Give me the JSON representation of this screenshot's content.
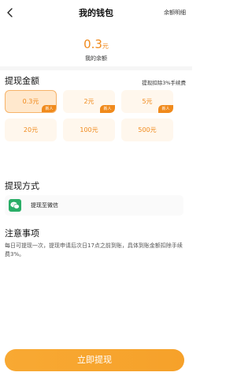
{
  "header": {
    "title": "我的钱包",
    "detail_label": "余额明细"
  },
  "balance": {
    "amount": "0.3",
    "unit": "元",
    "label": "我的余额"
  },
  "withdraw_amount": {
    "title": "提现金额",
    "fee_note": "提现扣除3%手续费",
    "badge": "新人",
    "options": [
      {
        "label": "0.3元",
        "new_user": true,
        "selected": true
      },
      {
        "label": "2元",
        "new_user": true,
        "selected": false
      },
      {
        "label": "5元",
        "new_user": true,
        "selected": false
      },
      {
        "label": "20元",
        "new_user": false,
        "selected": false
      },
      {
        "label": "100元",
        "new_user": false,
        "selected": false
      },
      {
        "label": "500元",
        "new_user": false,
        "selected": false
      }
    ]
  },
  "withdraw_method": {
    "title": "提现方式",
    "option_label": "提现至微信",
    "icon": "wechat-icon"
  },
  "notice": {
    "title": "注意事项",
    "text": "每日可提现一次，提现申请后次日17点之前到账，具体到账金额扣除手续费3%。"
  },
  "actions": {
    "withdraw_label": "立即提现"
  },
  "colors": {
    "accent": "#f08a1c",
    "button": "#f8a933",
    "wechat": "#2aae67"
  }
}
